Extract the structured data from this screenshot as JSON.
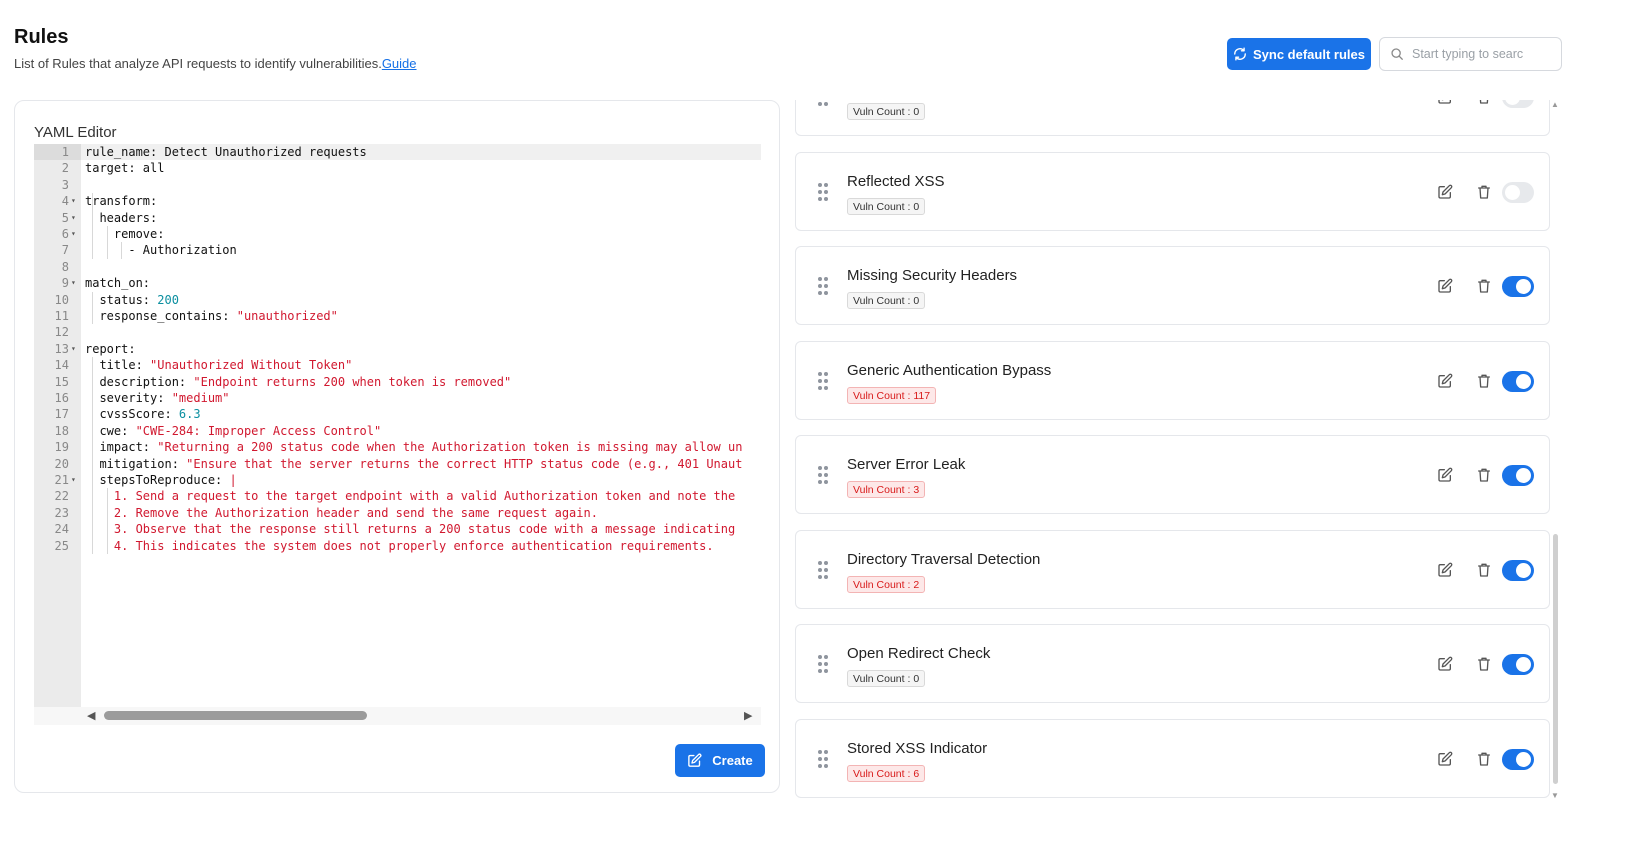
{
  "header": {
    "title": "Rules",
    "subtitle": "List of Rules that analyze API requests to identify vulnerabilities.",
    "guide_link": "Guide",
    "sync_button": "Sync default rules",
    "search_placeholder": "Start typing to searc"
  },
  "editor": {
    "label": "YAML Editor",
    "create_button": "Create",
    "lines": [
      {
        "n": "1",
        "fold": false,
        "code": "rule_name: Detect Unauthorized requests"
      },
      {
        "n": "2",
        "fold": false,
        "code": "target: all"
      },
      {
        "n": "3",
        "fold": false,
        "code": ""
      },
      {
        "n": "4",
        "fold": true,
        "code": "transform:"
      },
      {
        "n": "5",
        "fold": true,
        "code": "  headers:"
      },
      {
        "n": "6",
        "fold": true,
        "code": "    remove:"
      },
      {
        "n": "7",
        "fold": false,
        "code": "      - Authorization"
      },
      {
        "n": "8",
        "fold": false,
        "code": ""
      },
      {
        "n": "9",
        "fold": true,
        "code": "match_on:"
      },
      {
        "n": "10",
        "fold": false,
        "code": "  status: ",
        "num": "200"
      },
      {
        "n": "11",
        "fold": false,
        "code": "  response_contains: ",
        "str": "\"unauthorized\""
      },
      {
        "n": "12",
        "fold": false,
        "code": ""
      },
      {
        "n": "13",
        "fold": true,
        "code": "report:"
      },
      {
        "n": "14",
        "fold": false,
        "code": "  title: ",
        "str": "\"Unauthorized Without Token\""
      },
      {
        "n": "15",
        "fold": false,
        "code": "  description: ",
        "str": "\"Endpoint returns 200 when token is removed\""
      },
      {
        "n": "16",
        "fold": false,
        "code": "  severity: ",
        "str": "\"medium\""
      },
      {
        "n": "17",
        "fold": false,
        "code": "  cvssScore: ",
        "num": "6.3"
      },
      {
        "n": "18",
        "fold": false,
        "code": "  cwe: ",
        "str": "\"CWE-284: Improper Access Control\""
      },
      {
        "n": "19",
        "fold": false,
        "code": "  impact: ",
        "str": "\"Returning a 200 status code when the Authorization token is missing may allow un"
      },
      {
        "n": "20",
        "fold": false,
        "code": "  mitigation: ",
        "str": "\"Ensure that the server returns the correct HTTP status code (e.g., 401 Unaut"
      },
      {
        "n": "21",
        "fold": true,
        "code": "  stepsToReproduce: ",
        "str": "|"
      },
      {
        "n": "22",
        "fold": false,
        "code": "    ",
        "str": "1. Send a request to the target endpoint with a valid Authorization token and note the"
      },
      {
        "n": "23",
        "fold": false,
        "code": "    ",
        "str": "2. Remove the Authorization header and send the same request again."
      },
      {
        "n": "24",
        "fold": false,
        "code": "    ",
        "str": "3. Observe that the response still returns a 200 status code with a message indicating"
      },
      {
        "n": "25",
        "fold": false,
        "code": "    ",
        "str": "4. This indicates the system does not properly enforce authentication requirements."
      }
    ]
  },
  "rules": [
    {
      "name": "",
      "vuln": "Vuln Count : 0",
      "hot": false,
      "enabled": false
    },
    {
      "name": "Reflected XSS",
      "vuln": "Vuln Count : 0",
      "hot": false,
      "enabled": false
    },
    {
      "name": "Missing Security Headers",
      "vuln": "Vuln Count : 0",
      "hot": false,
      "enabled": true
    },
    {
      "name": "Generic Authentication Bypass",
      "vuln": "Vuln Count : 117",
      "hot": true,
      "enabled": true
    },
    {
      "name": "Server Error Leak",
      "vuln": "Vuln Count : 3",
      "hot": true,
      "enabled": true
    },
    {
      "name": "Directory Traversal Detection",
      "vuln": "Vuln Count : 2",
      "hot": true,
      "enabled": true
    },
    {
      "name": "Open Redirect Check",
      "vuln": "Vuln Count : 0",
      "hot": false,
      "enabled": true
    },
    {
      "name": "Stored XSS Indicator",
      "vuln": "Vuln Count : 6",
      "hot": true,
      "enabled": true
    }
  ],
  "colors": {
    "accent": "#1a73e8",
    "string": "#d1182f",
    "number": "#0b8fa0",
    "badge_hot_bg": "#fde8e8",
    "badge_hot_text": "#d81b1b"
  }
}
